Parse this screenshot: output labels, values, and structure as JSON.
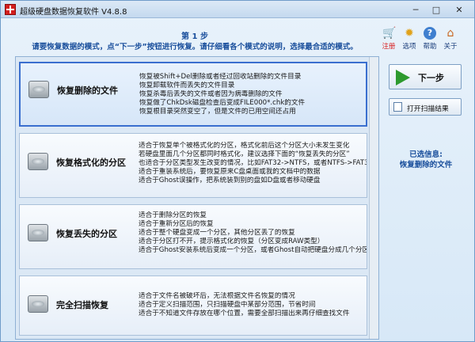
{
  "window": {
    "title": "超级硬盘数据恢复软件 V4.8.8",
    "minimize": "─",
    "maximize": "□",
    "close": "✕"
  },
  "header": {
    "step_title": "第 1 步",
    "instruction": "请要恢复数据的模式，点“下一步”按钮进行恢复。请仔细看各个模式的说明，选择最合适的模式。"
  },
  "toolbar": [
    {
      "label": "注册",
      "icon": "cart-icon"
    },
    {
      "label": "选项",
      "icon": "gear-icon"
    },
    {
      "label": "帮助",
      "icon": "help-icon"
    },
    {
      "label": "关于",
      "icon": "house-icon"
    }
  ],
  "modes": [
    {
      "title": "恢复删除的文件",
      "icon": "hard-drive-icon",
      "selected": true,
      "desc": [
        "恢复被Shift+Del删除或者经过回收站删除的文件目录",
        "恢复卸载软件而丢失的文件目录",
        "恢复杀毒后丢失的文件或者因为病毒删除的文件",
        "恢复做了ChkDsk磁盘检查后变成FILE000*.chk的文件",
        "恢复根目录突然变空了，但是文件的已用空间还占用"
      ]
    },
    {
      "title": "恢复格式化的分区",
      "icon": "hard-drive-icon",
      "selected": false,
      "desc": [
        "适合于恢复单个被格式化的分区，格式化前后这个分区大小未发生变化",
        "若硬盘里面几个分区都同时格式化，建议选择下面的“恢复丢失的分区”",
        "也适合于分区类型发生改变的情况，比如FAT32->NTFS，或者NTFS->FAT32",
        "适合于重装系统后，要恢复原来C盘桌面或我的文档中的数据",
        "适合于Ghost误操作，把系统装到别的盘如D盘或者移动硬盘"
      ]
    },
    {
      "title": "恢复丢失的分区",
      "icon": "hard-drive-icon",
      "selected": false,
      "desc": [
        "适合于删除分区的恢复",
        "适合于重新分区后的恢复",
        "适合于整个硬盘变成一个分区，其他分区丢了的恢复",
        "适合于分区打不开，提示格式化的恢复（分区变成RAW类型）",
        "适合于Ghost安装系统后变成一个分区，或者Ghost自动把硬盘分成几个分区"
      ]
    },
    {
      "title": "完全扫描恢复",
      "icon": "hard-drive-icon",
      "selected": false,
      "desc": [
        "适合于文件名被破坏后，无法根据文件名恢复的情况",
        "适合于定义扫描范围，只扫描硬盘中某部分范围，节省时间",
        "适合于不知道文件存放在哪个位置，需要全部扫描出来再仔细查找文件"
      ]
    }
  ],
  "side_panel": {
    "next_label": "下一步",
    "open_scan_label": "打开扫描结果",
    "selected_info_label": "已选信息:",
    "selected_info_value": "恢复删除的文件"
  },
  "colors": {
    "accent_blue": "#1a4f9c",
    "register_red": "#d81e1e",
    "next_green": "#2e9a2e",
    "selected_border": "#3a6fcf"
  }
}
